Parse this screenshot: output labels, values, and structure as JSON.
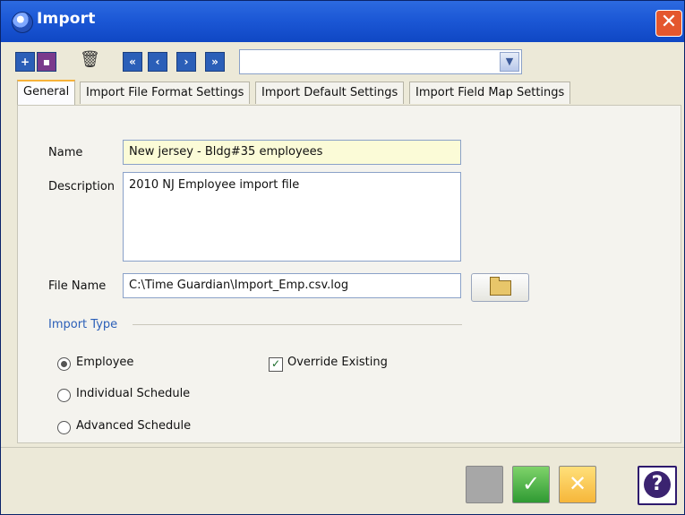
{
  "window": {
    "title": "Import",
    "close_label": "✕"
  },
  "toolbar": {
    "icons": [
      "add-icon",
      "save-icon",
      "delete-icon",
      "first-record-icon",
      "previous-record-icon",
      "next-record-icon",
      "last-record-icon"
    ],
    "record_selector": {
      "value": ""
    }
  },
  "tabs": [
    {
      "label": "General",
      "active": true
    },
    {
      "label": "Import File Format Settings",
      "active": false
    },
    {
      "label": "Import Default Settings",
      "active": false
    },
    {
      "label": "Import Field Map Settings",
      "active": false
    }
  ],
  "form": {
    "name_label": "Name",
    "name_value": "New jersey - Bldg#35 employees",
    "description_label": "Description",
    "description_value": "2010 NJ Employee import file",
    "filename_label": "File Name",
    "filename_value": "C:\\Time Guardian\\Import_Emp.csv.log"
  },
  "import_type": {
    "heading": "Import Type",
    "options": [
      {
        "label": "Employee",
        "selected": true
      },
      {
        "label": "Individual Schedule",
        "selected": false
      },
      {
        "label": "Advanced Schedule",
        "selected": false
      }
    ],
    "override_label": "Override Existing",
    "override_checked": true
  },
  "buttons": {
    "ok": "✓",
    "cancel": "✕",
    "help": "?"
  },
  "colors": {
    "title_bar": "#1c58d6",
    "accent": "#2b5fb8",
    "tab_highlight": "#f7b23a"
  }
}
